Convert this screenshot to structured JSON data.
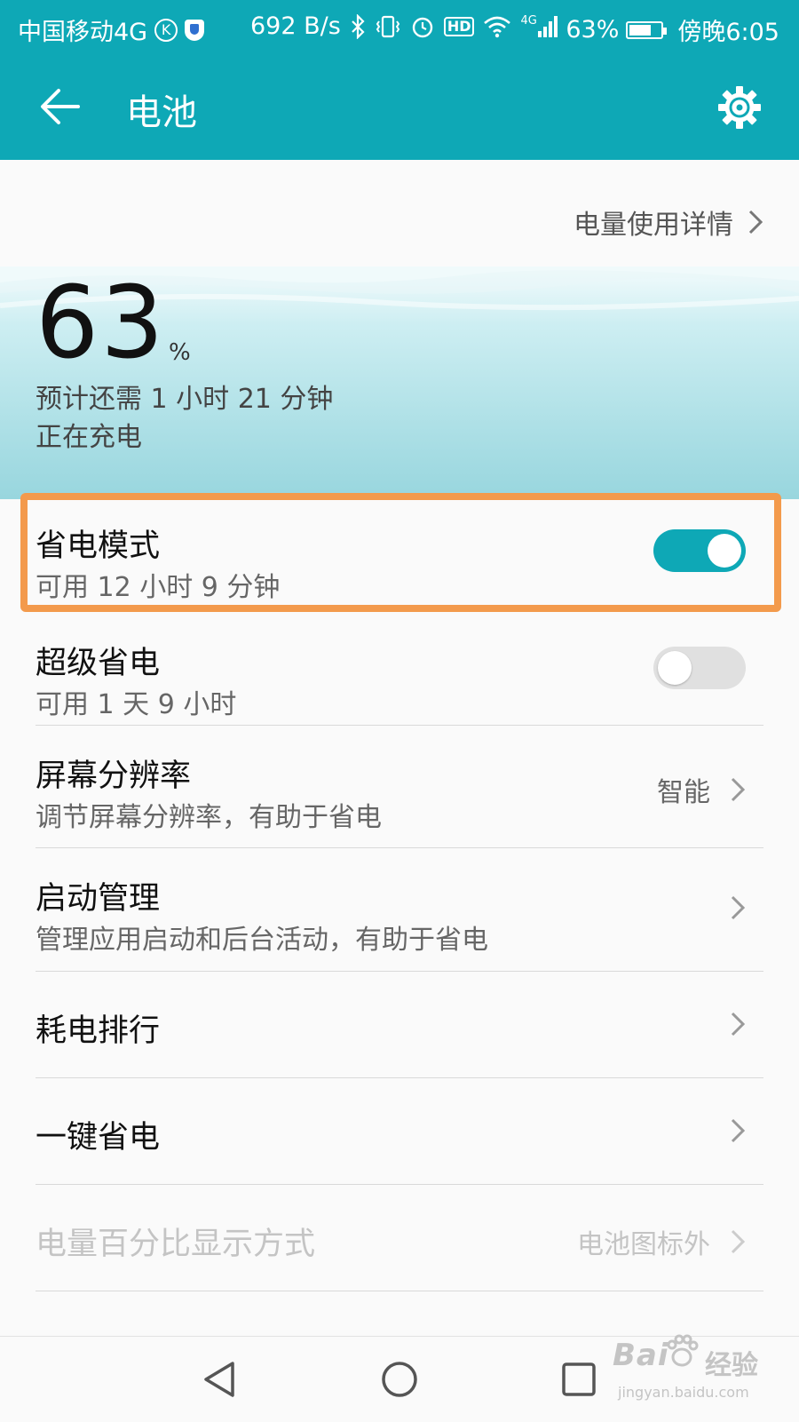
{
  "status_bar": {
    "carrier": "中国移动4G",
    "k_badge": "K",
    "net_speed": "692 B/s",
    "hd_badge": "HD",
    "signal_type": "4G",
    "battery_percent": "63%",
    "time": "傍晚6:05"
  },
  "app_bar": {
    "title": "电池",
    "back_icon": "arrow-left-icon",
    "settings_icon": "gear-icon",
    "color": "#0ea8b6"
  },
  "usage_details": {
    "label": "电量使用详情"
  },
  "battery_summary": {
    "level": "63",
    "unit": "%",
    "estimate": "预计还需 1 小时 21 分钟",
    "charge_state": "正在充电"
  },
  "settings": [
    {
      "title": "省电模式",
      "subtitle": "可用 12 小时 9 分钟",
      "toggle": true,
      "highlighted": true
    },
    {
      "title": "超级省电",
      "subtitle": "可用 1 天 9 小时",
      "toggle": false
    },
    {
      "title": "屏幕分辨率",
      "subtitle": "调节屏幕分辨率，有助于省电",
      "value": "智能"
    },
    {
      "title": "启动管理",
      "subtitle": "管理应用启动和后台活动，有助于省电"
    },
    {
      "title": "耗电排行"
    },
    {
      "title": "一键省电"
    },
    {
      "title": "电量百分比显示方式",
      "value": "电池图标外",
      "disabled": true
    }
  ],
  "nav_bar": {
    "back_icon": "triangle-back-icon",
    "home_icon": "circle-home-icon",
    "recents_icon": "square-recents-icon"
  },
  "watermark": {
    "brand": "Bai",
    "brand_cn": "经验",
    "url": "jingyan.baidu.com"
  },
  "colors": {
    "accent": "#0ea8b6",
    "highlight_border": "#f39a4c"
  }
}
